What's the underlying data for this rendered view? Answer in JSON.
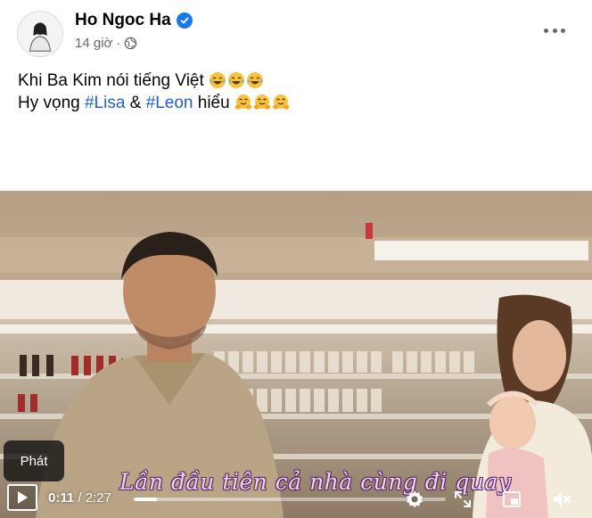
{
  "post": {
    "author": "Ho Ngoc Ha",
    "time": "14 giờ",
    "audience_icon": "globe-icon",
    "line1": "Khi Ba Kim nói tiếng Việt",
    "line1_emojis": [
      "laughing-tears-emoji",
      "laughing-tears-emoji",
      "laughing-tears-emoji"
    ],
    "line2_prefix": "Hy vọng ",
    "hashtag1": "#Lisa",
    "amp": " & ",
    "hashtag2": "#Leon",
    "line2_suffix": " hiểu ",
    "line2_emojis": [
      "hugging-emoji",
      "hugging-emoji",
      "hugging-emoji"
    ]
  },
  "video": {
    "tooltip": "Phát",
    "subtitle": "Lần đầu tiên cả nhà cùng đi quay",
    "current_time": "0:11",
    "separator": " / ",
    "total_time": "2:27",
    "progress": 0.0748
  },
  "colors": {
    "accent": "#1877f2",
    "hashtag": "#1b62d6",
    "muted": "#65676b"
  }
}
